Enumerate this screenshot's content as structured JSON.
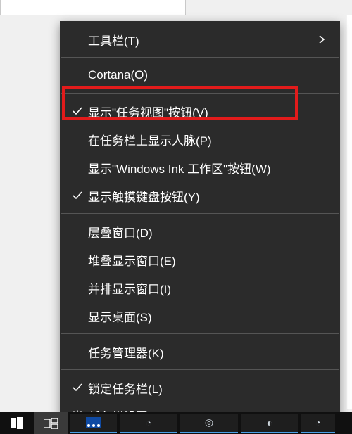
{
  "menu": {
    "items": [
      {
        "label": "工具栏(T)",
        "lead": null,
        "tail": "chevron"
      },
      {
        "sep": true
      },
      {
        "label": "Cortana(O)",
        "lead": null,
        "tail": null
      },
      {
        "sep": true
      },
      {
        "label": "显示\"任务视图\"按钮(V)",
        "lead": "check",
        "tail": null,
        "highlight": true
      },
      {
        "label": "在任务栏上显示人脉(P)",
        "lead": null,
        "tail": null
      },
      {
        "label": "显示\"Windows Ink 工作区\"按钮(W)",
        "lead": null,
        "tail": null
      },
      {
        "label": "显示触摸键盘按钮(Y)",
        "lead": "check",
        "tail": null
      },
      {
        "sep": true
      },
      {
        "label": "层叠窗口(D)",
        "lead": null,
        "tail": null
      },
      {
        "label": "堆叠显示窗口(E)",
        "lead": null,
        "tail": null
      },
      {
        "label": "并排显示窗口(I)",
        "lead": null,
        "tail": null
      },
      {
        "label": "显示桌面(S)",
        "lead": null,
        "tail": null
      },
      {
        "sep": true
      },
      {
        "label": "任务管理器(K)",
        "lead": null,
        "tail": null
      },
      {
        "sep": true
      },
      {
        "label": "锁定任务栏(L)",
        "lead": "check",
        "tail": null
      },
      {
        "label": "任务栏设置(T)",
        "lead": "gear",
        "tail": null
      }
    ]
  },
  "taskbar": {
    "start": "⊞",
    "taskview": "⧉"
  }
}
